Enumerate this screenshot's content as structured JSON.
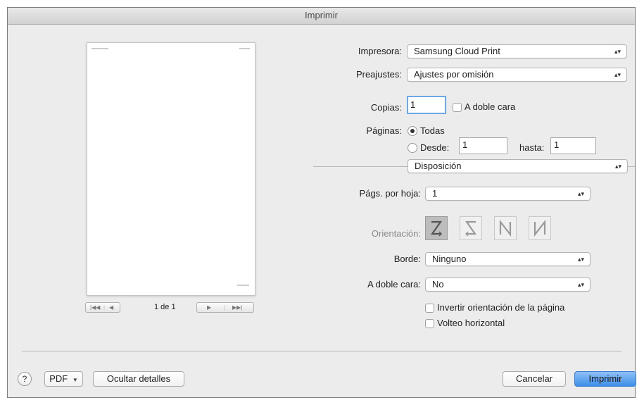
{
  "window": {
    "title": "Imprimir"
  },
  "preview": {
    "page_indicator": "1 de 1"
  },
  "printer": {
    "label": "Impresora:",
    "value": "Samsung Cloud Print"
  },
  "presets": {
    "label": "Preajustes:",
    "value": "Ajustes por omisión"
  },
  "copies": {
    "label": "Copias:",
    "value": "1",
    "two_sided_label": "A doble cara"
  },
  "pages": {
    "label": "Páginas:",
    "all_label": "Todas",
    "from_label": "Desde:",
    "from_value": "1",
    "to_label": "hasta:",
    "to_value": "1"
  },
  "section": {
    "value": "Disposición"
  },
  "layout": {
    "pages_per_sheet_label": "Págs. por hoja:",
    "pages_per_sheet_value": "1",
    "orientation_label": "Orientación:",
    "border_label": "Borde:",
    "border_value": "Ninguno",
    "two_sided_label": "A doble cara:",
    "two_sided_value": "No",
    "reverse_orientation_label": "Invertir orientación de la página",
    "flip_horizontal_label": "Volteo horizontal"
  },
  "footer": {
    "help": "?",
    "pdf_label": "PDF",
    "hide_details_label": "Ocultar detalles",
    "cancel_label": "Cancelar",
    "print_label": "Imprimir"
  },
  "icons": {
    "popup_arrow": "updown-chevron-icon",
    "pdf_arrow": "dropdown-triangle-icon"
  }
}
